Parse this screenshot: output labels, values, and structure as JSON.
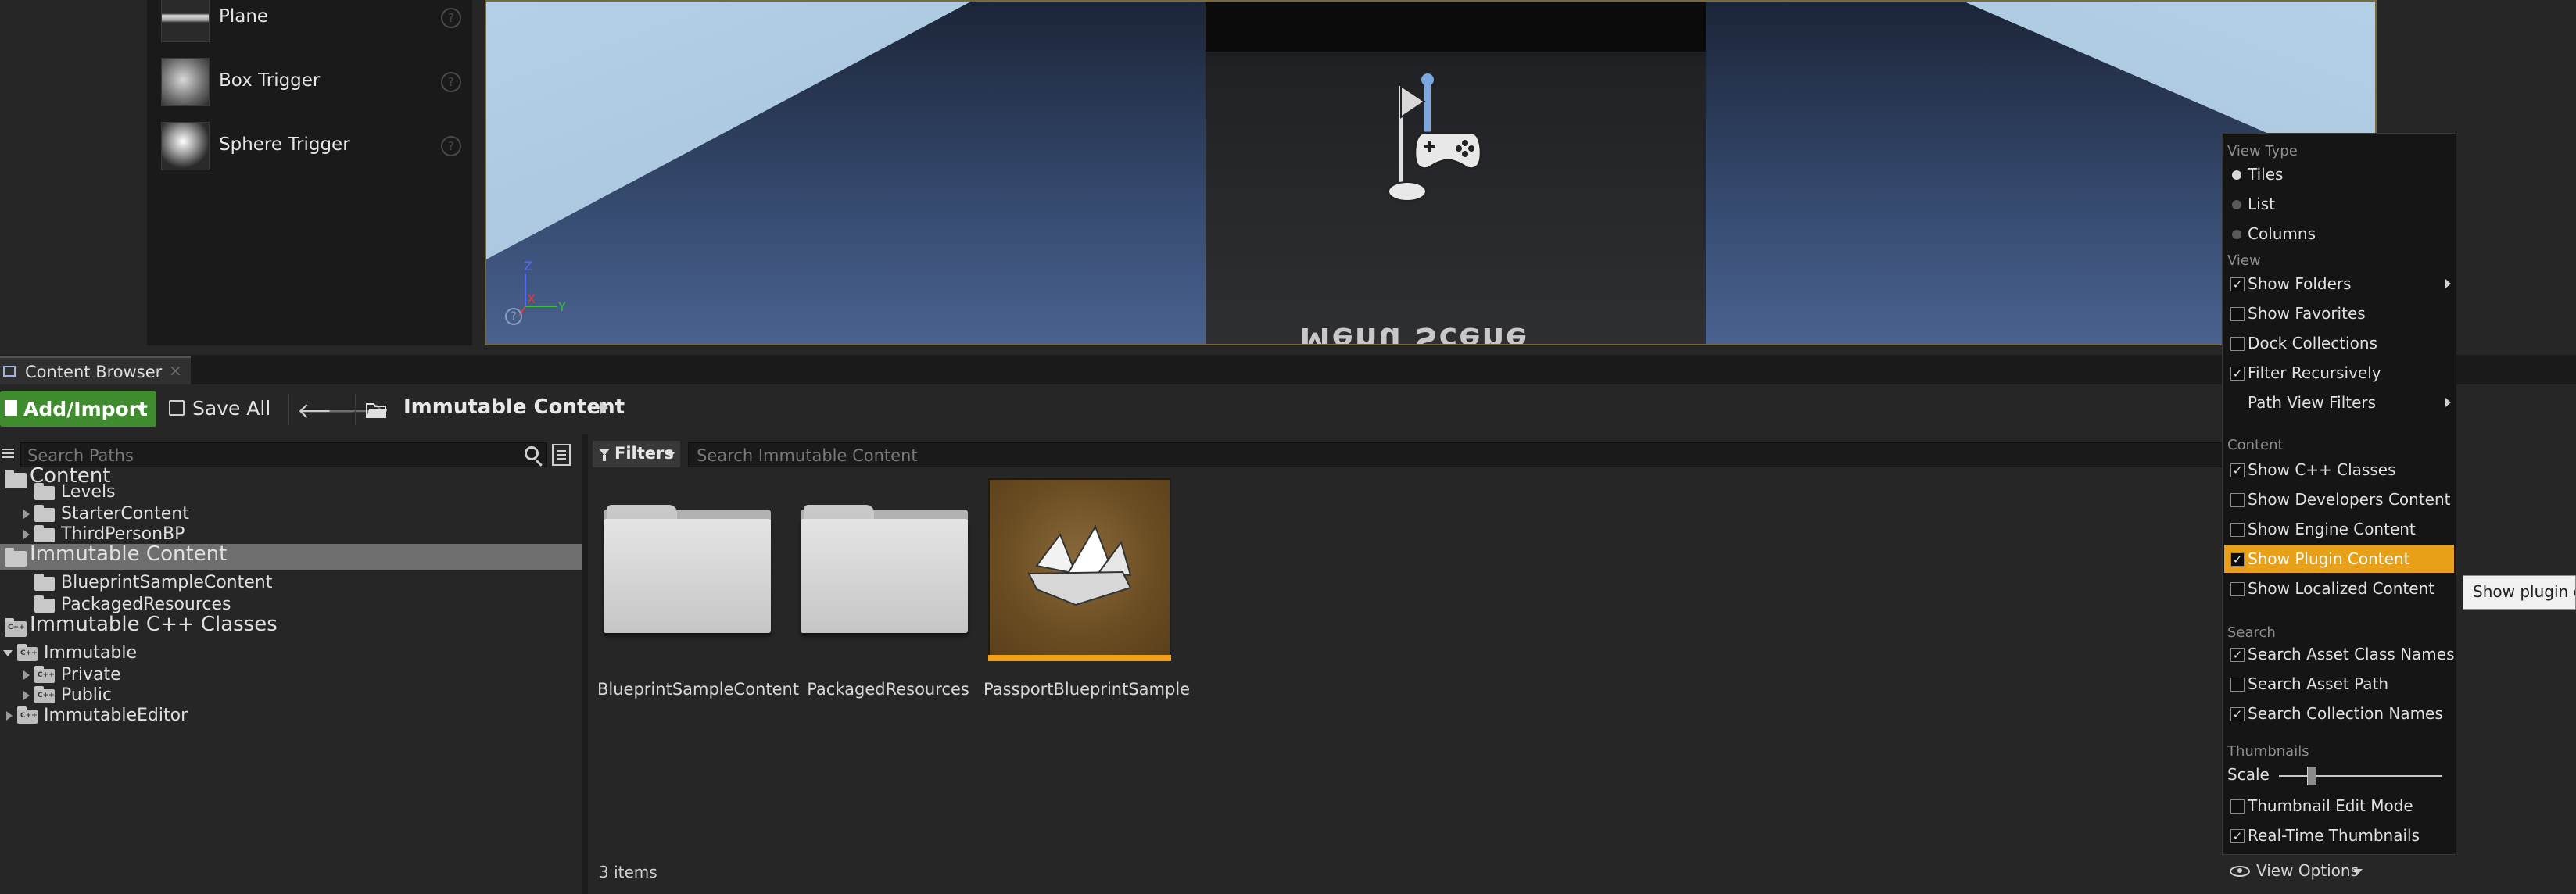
{
  "place_panel": {
    "items": [
      {
        "label": "Plane",
        "icon": "plane-thumbnail"
      },
      {
        "label": "Box Trigger",
        "icon": "box-trigger-thumbnail"
      },
      {
        "label": "Sphere Trigger",
        "icon": "sphere-trigger-thumbnail"
      }
    ]
  },
  "viewport": {
    "mirrored_text": "Menu Scene",
    "axis_labels": {
      "z": "Z",
      "x": "X",
      "y": "Y"
    }
  },
  "tab": {
    "label": "Content Browser",
    "close": "×"
  },
  "toolbar": {
    "add_import_label": "Add/Import",
    "save_all_label": "Save All",
    "back_glyph": "🡐",
    "forward_glyph": "🡒",
    "breadcrumb": "Immutable Content"
  },
  "paths": {
    "search_placeholder": "Search Paths",
    "tree": [
      {
        "label": "Content",
        "level": 0,
        "big": true,
        "expanded": true,
        "kind": "folder"
      },
      {
        "label": "Levels",
        "level": 1,
        "kind": "folder"
      },
      {
        "label": "StarterContent",
        "level": 1,
        "collapsed": true,
        "kind": "folder"
      },
      {
        "label": "ThirdPersonBP",
        "level": 1,
        "collapsed": true,
        "kind": "folder"
      },
      {
        "label": "Immutable Content",
        "level": 0,
        "big": true,
        "expanded": true,
        "selected": true,
        "kind": "folder"
      },
      {
        "label": "BlueprintSampleContent",
        "level": 1,
        "kind": "folder"
      },
      {
        "label": "PackagedResources",
        "level": 1,
        "kind": "folder"
      },
      {
        "label": "Immutable C++ Classes",
        "level": 0,
        "big": true,
        "expanded": true,
        "kind": "cpp"
      },
      {
        "label": "Immutable",
        "level": 0,
        "expanded": true,
        "kind": "cpp"
      },
      {
        "label": "Private",
        "level": 1,
        "collapsed": true,
        "kind": "cpp"
      },
      {
        "label": "Public",
        "level": 1,
        "collapsed": true,
        "kind": "cpp"
      },
      {
        "label": "ImmutableEditor",
        "level": 0,
        "collapsed": true,
        "kind": "cpp"
      }
    ]
  },
  "content": {
    "filters_label": "Filters",
    "search_placeholder": "Search Immutable Content",
    "assets": [
      {
        "label": "BlueprintSampleContent",
        "type": "folder"
      },
      {
        "label": "PackagedResources",
        "type": "folder"
      },
      {
        "label": "PassportBlueprintSample",
        "type": "blueprint",
        "accent": "#f0a01a"
      }
    ],
    "item_count": "3 items",
    "view_options_label": "View Options"
  },
  "view_menu": {
    "sections": [
      {
        "header": "View Type",
        "items": [
          {
            "label": "Tiles",
            "kind": "radio",
            "checked": true
          },
          {
            "label": "List",
            "kind": "radio",
            "checked": false
          },
          {
            "label": "Columns",
            "kind": "radio",
            "checked": false
          }
        ]
      },
      {
        "header": "View",
        "items": [
          {
            "label": "Show Folders",
            "kind": "check",
            "checked": true,
            "submenu": true
          },
          {
            "label": "Show Favorites",
            "kind": "check",
            "checked": false
          },
          {
            "label": "Dock Collections",
            "kind": "check",
            "checked": false
          },
          {
            "label": "Filter Recursively",
            "kind": "check",
            "checked": true
          },
          {
            "label": "Path View Filters",
            "kind": "none",
            "submenu": true
          }
        ]
      },
      {
        "header": "Content",
        "items": [
          {
            "label": "Show C++ Classes",
            "kind": "check",
            "checked": true
          },
          {
            "label": "Show Developers Content",
            "kind": "check",
            "checked": false
          },
          {
            "label": "Show Engine Content",
            "kind": "check",
            "checked": false
          },
          {
            "label": "Show Plugin Content",
            "kind": "check",
            "checked": true,
            "highlight": true
          },
          {
            "label": "Show Localized Content",
            "kind": "check",
            "checked": false
          }
        ]
      },
      {
        "header": "Search",
        "items": [
          {
            "label": "Search Asset Class Names",
            "kind": "check",
            "checked": true
          },
          {
            "label": "Search Asset Path",
            "kind": "check",
            "checked": false
          },
          {
            "label": "Search Collection Names",
            "kind": "check",
            "checked": true
          }
        ]
      },
      {
        "header": "Thumbnails",
        "items": []
      }
    ],
    "scale_label": "Scale",
    "scale_value": 0.2,
    "thumbnail_items": [
      {
        "label": "Thumbnail Edit Mode",
        "kind": "check",
        "checked": false
      },
      {
        "label": "Real-Time Thumbnails",
        "kind": "check",
        "checked": true
      }
    ],
    "highlight_color": "#e8a019"
  },
  "tooltip": {
    "text": "Show plugin co"
  }
}
